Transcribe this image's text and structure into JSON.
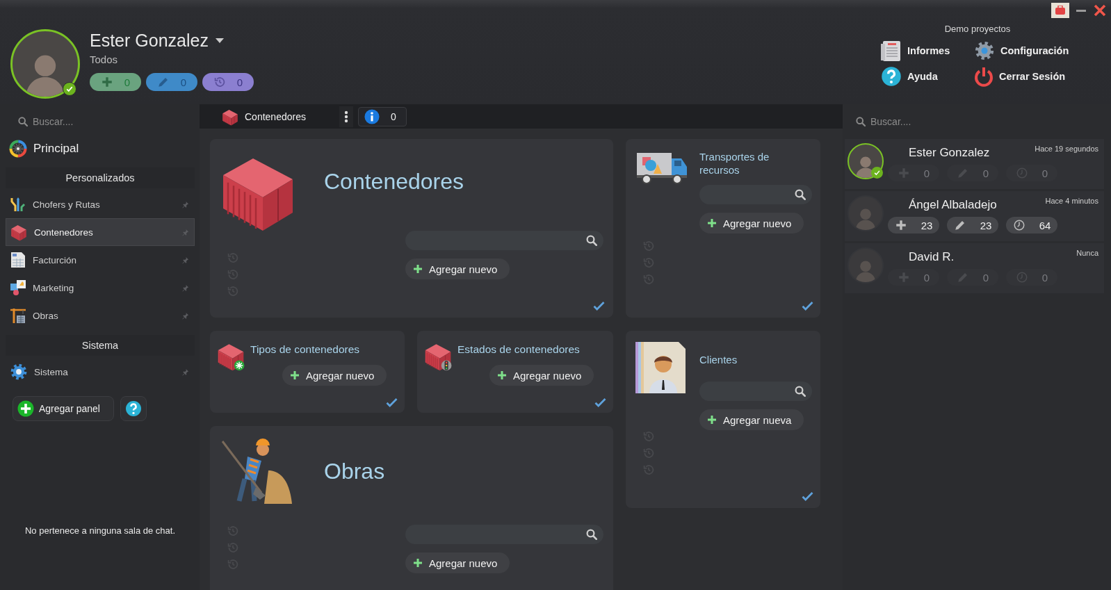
{
  "header": {
    "user": {
      "name": "Ester Gonzalez",
      "filter": "Todos",
      "online": true,
      "counters": [
        {
          "kind": "added",
          "value": "0"
        },
        {
          "kind": "edited",
          "value": "0"
        },
        {
          "kind": "history",
          "value": "0"
        }
      ]
    },
    "project": {
      "title": "Demo proyectos",
      "links": [
        {
          "kind": "reports",
          "label": "Informes"
        },
        {
          "kind": "settings",
          "label": "Configuración"
        },
        {
          "kind": "help",
          "label": "Ayuda"
        },
        {
          "kind": "logout",
          "label": "Cerrar Sesión"
        }
      ]
    }
  },
  "sidebar": {
    "search": {
      "placeholder": "Buscar...."
    },
    "home": "Principal",
    "sections": [
      {
        "title": "Personalizados",
        "items": [
          {
            "label": "Chofers y Rutas",
            "selected": false
          },
          {
            "label": "Contenedores",
            "selected": true
          },
          {
            "label": "Facturción",
            "selected": false
          },
          {
            "label": "Marketing",
            "selected": false
          },
          {
            "label": "Obras",
            "selected": false
          }
        ]
      },
      {
        "title": "Sistema",
        "items": [
          {
            "label": "Sistema",
            "selected": false
          }
        ]
      }
    ],
    "add_panel": "Agregar panel",
    "chat_notice": "No pertenece a ninguna sala de chat."
  },
  "toolbar": {
    "tab": {
      "label": "Contenedores"
    },
    "info_count": "0"
  },
  "cards": [
    {
      "kind": "large",
      "title": "Contenedores",
      "add": "Agregar nuevo"
    },
    {
      "kind": "medium",
      "title": "Transportes de recursos",
      "add": "Agregar nuevo"
    },
    {
      "kind": "small",
      "title": "Tipos de contenedores",
      "add": "Agregar nuevo"
    },
    {
      "kind": "small",
      "title": "Estados de contenedores",
      "add": "Agregar nuevo"
    },
    {
      "kind": "medium",
      "title": "Clientes",
      "add": "Agregar nueva"
    },
    {
      "kind": "large",
      "title": "Obras",
      "add": "Agregar nuevo"
    }
  ],
  "users": {
    "search": {
      "placeholder": "Buscar...."
    },
    "items": [
      {
        "name": "Ester Gonzalez",
        "last_seen": "Hace 19 segundos",
        "online": true,
        "highlighted": false,
        "counters": [
          {
            "kind": "added",
            "value": "0"
          },
          {
            "kind": "edited",
            "value": "0"
          },
          {
            "kind": "history",
            "value": "0"
          }
        ]
      },
      {
        "name": "Ángel Albaladejo",
        "last_seen": "Hace 4 minutos",
        "online": false,
        "highlighted": true,
        "counters": [
          {
            "kind": "added",
            "value": "23"
          },
          {
            "kind": "edited",
            "value": "23"
          },
          {
            "kind": "history",
            "value": "64"
          }
        ]
      },
      {
        "name": "David R.",
        "last_seen": "Nunca",
        "online": false,
        "highlighted": false,
        "counters": [
          {
            "kind": "added",
            "value": "0"
          },
          {
            "kind": "edited",
            "value": "0"
          },
          {
            "kind": "history",
            "value": "0"
          }
        ]
      }
    ]
  }
}
